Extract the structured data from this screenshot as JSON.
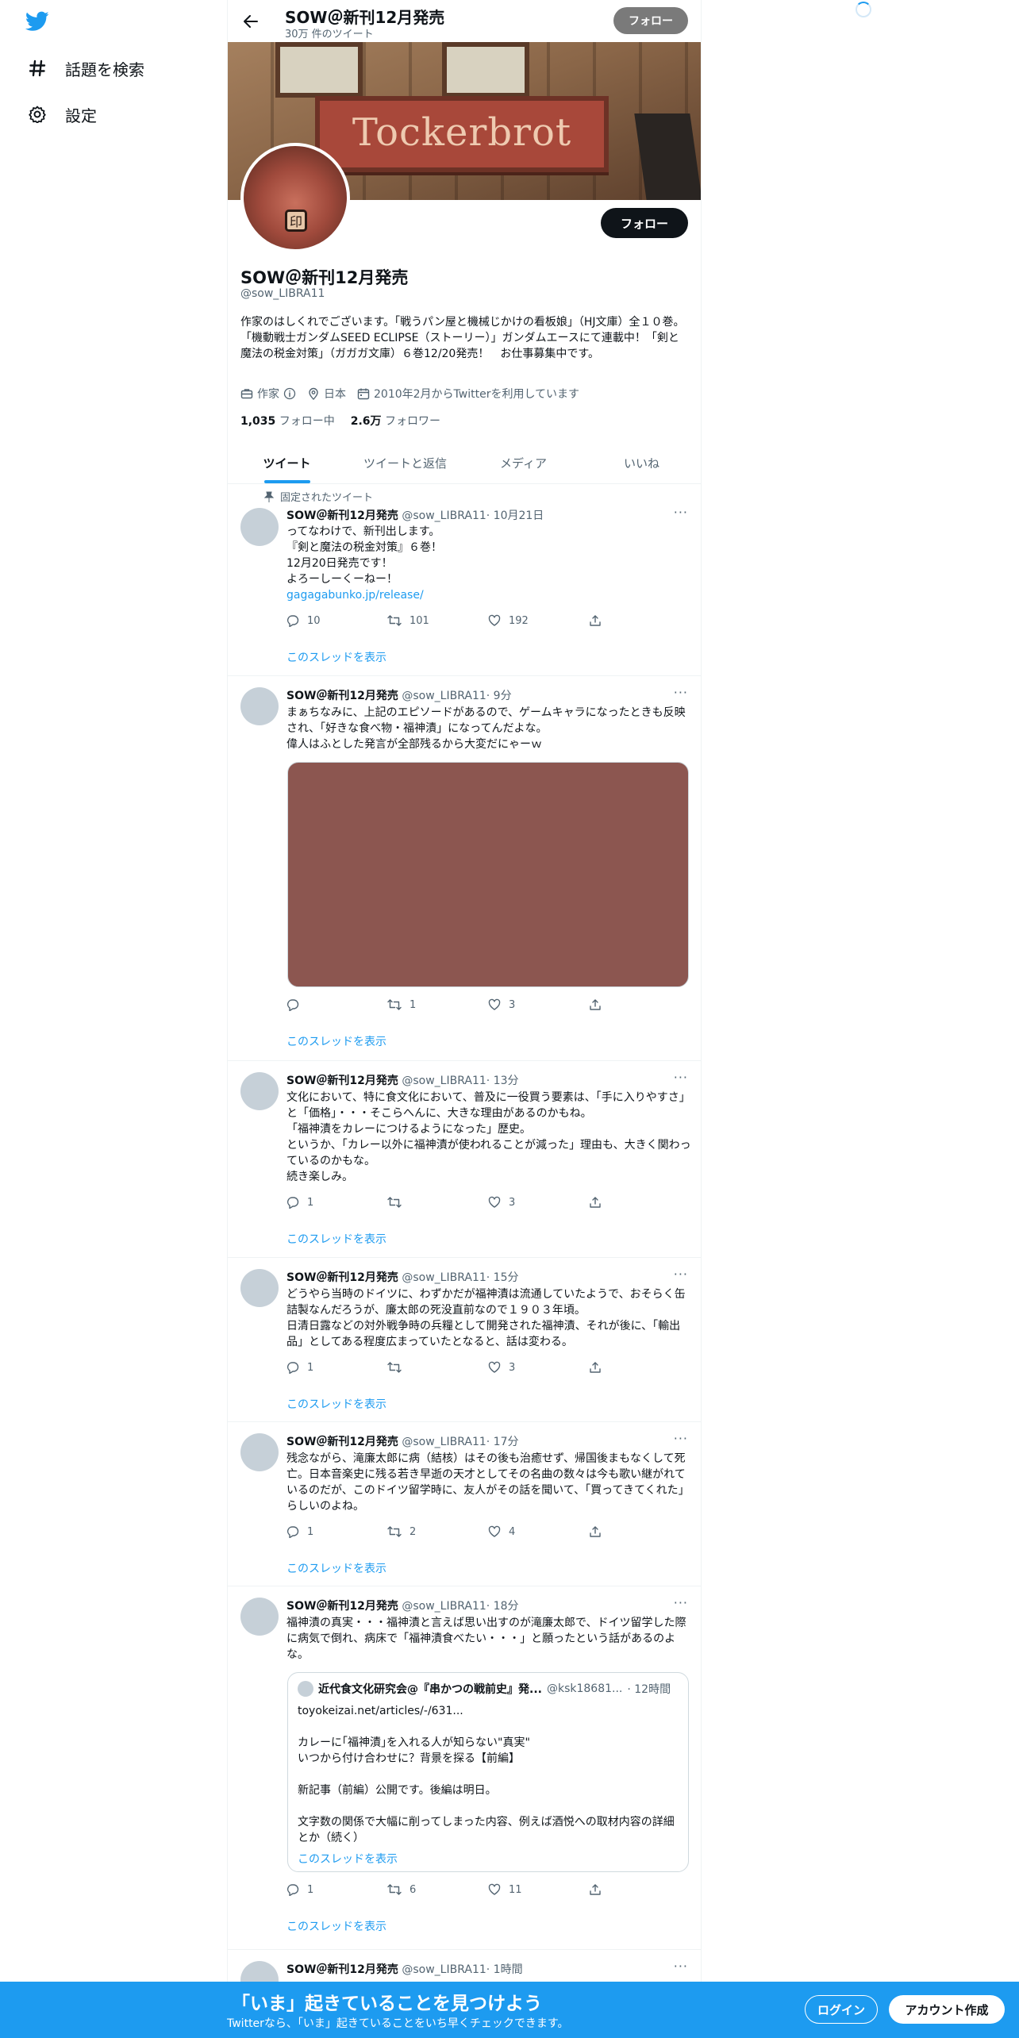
{
  "sidebar": {
    "items": [
      {
        "label": "話題を検索",
        "icon": "hashtag-icon"
      },
      {
        "label": "設定",
        "icon": "gear-icon"
      }
    ]
  },
  "header": {
    "title": "SOW＠新刊12月発売",
    "tweet_count": "30万 件のツイート",
    "follow_label": "フォロー"
  },
  "banner": {
    "sign_text": "Tockerbrot"
  },
  "profile": {
    "name": "SOW＠新刊12月発売",
    "handle": "@sow_LIBRA11",
    "bio": "作家のはしくれでございます。「戦うパン屋と機械じかけの看板娘」（HJ文庫）全１０巻。「機動戦士ガンダムSEED ECLIPSE（ストーリー）」ガンダムエースにて連載中！「剣と魔法の税金対策」（ガガガ文庫）６巻12/20発売！　お仕事募集中です。",
    "category": "作家",
    "location": "日本",
    "joined": "2010年2月からTwitterを利用しています",
    "following_count": "1,035",
    "following_label": "フォロー中",
    "followers_count": "2.6万",
    "followers_label": "フォロワー",
    "follow_label": "フォロー"
  },
  "tabs": [
    "ツイート",
    "ツイートと返信",
    "メディア",
    "いいね"
  ],
  "tweets": [
    {
      "pinned_label": "固定されたツイート",
      "name": "SOW＠新刊12月発売",
      "handle": "@sow_LIBRA11",
      "time": "· 10月21日",
      "text": "ってなわけで、新刊出します。\n『剣と魔法の税金対策』６巻！\n12月20日発売です！\nよろーしーくーねー！",
      "link": "gagagabunko.jp/release/",
      "replies": "10",
      "retweets": "101",
      "likes": "192",
      "thread": "このスレッドを表示"
    },
    {
      "name": "SOW＠新刊12月発売",
      "handle": "@sow_LIBRA11",
      "time": "· 9分",
      "text": "まぁちなみに、上記のエピソードがあるので、ゲームキャラになったときも反映され、「好きな食べ物・福神漬」になってんだよな。\n偉人はふとした発言が全部残るから大変だにゃーｗ",
      "replies": "",
      "retweets": "1",
      "likes": "3",
      "thread": "このスレッドを表示"
    },
    {
      "name": "SOW＠新刊12月発売",
      "handle": "@sow_LIBRA11",
      "time": "· 13分",
      "text": "文化において、特に食文化において、普及に一役買う要素は、「手に入りやすさ」と「価格」・・・そこらへんに、大きな理由があるのかもね。\n「福神漬をカレーにつけるようになった」歴史。\nというか、「カレー以外に福神漬が使われることが減った」理由も、大きく関わっているのかもな。\n続き楽しみ。",
      "replies": "1",
      "retweets": "",
      "likes": "3",
      "thread": "このスレッドを表示"
    },
    {
      "name": "SOW＠新刊12月発売",
      "handle": "@sow_LIBRA11",
      "time": "· 15分",
      "text": "どうやら当時のドイツに、わずかだが福神漬は流通していたようで、おそらく缶詰製なんだろうが、廉太郎の死没直前なので１９０３年頃。\n日清日露などの対外戦争時の兵糧として開発された福神漬、それが後に、「輸出品」としてある程度広まっていたとなると、話は変わる。",
      "replies": "1",
      "retweets": "",
      "likes": "3",
      "thread": "このスレッドを表示"
    },
    {
      "name": "SOW＠新刊12月発売",
      "handle": "@sow_LIBRA11",
      "time": "· 17分",
      "text": "残念ながら、滝廉太郎に病（結核）はその後も治癒せず、帰国後まもなくして死亡。日本音楽史に残る若き早逝の天才としてその名曲の数々は今も歌い継がれているのだが、このドイツ留学時に、友人がその話を聞いて、「買ってきてくれた」らしいのよね。",
      "replies": "1",
      "retweets": "2",
      "likes": "4",
      "thread": "このスレッドを表示"
    },
    {
      "name": "SOW＠新刊12月発売",
      "handle": "@sow_LIBRA11",
      "time": "· 18分",
      "text": "福神漬の真実・・・福神漬と言えば思い出すのが滝廉太郎で、ドイツ留学した際に病気で倒れ、病床で「福神漬食べたい・・・」と願ったという話があるのよな。",
      "quote": {
        "name": "近代食文化研究会@『串かつの戦前史』発...",
        "handle": "@ksk18681...",
        "time": "· 12時間",
        "text": "toyokeizai.net/articles/-/631...\n\nカレーに｢福神漬｣を入れる人が知らない\"真実\"\nいつから付け合わせに？背景を探る【前編】\n\n新記事（前編）公開です。後編は明日。\n\n文字数の関係で大幅に削ってしまった内容、例えば酒悦への取材内容の詳細とか（続く）",
        "thread": "このスレッドを表示"
      },
      "replies": "1",
      "retweets": "6",
      "likes": "11",
      "thread": "このスレッドを表示"
    },
    {
      "name": "SOW＠新刊12月発売",
      "handle": "@sow_LIBRA11",
      "time": "· 1時間"
    }
  ],
  "bottom_bar": {
    "title": "「いま」起きていることを見つけよう",
    "subtitle": "Twitterなら、「いま」起きていることをいち早くチェックできます。",
    "login_label": "ログイン",
    "signup_label": "アカウント作成"
  },
  "colors": {
    "accent": "#1d9bf0",
    "text": "#0f1419",
    "muted": "#536471"
  }
}
